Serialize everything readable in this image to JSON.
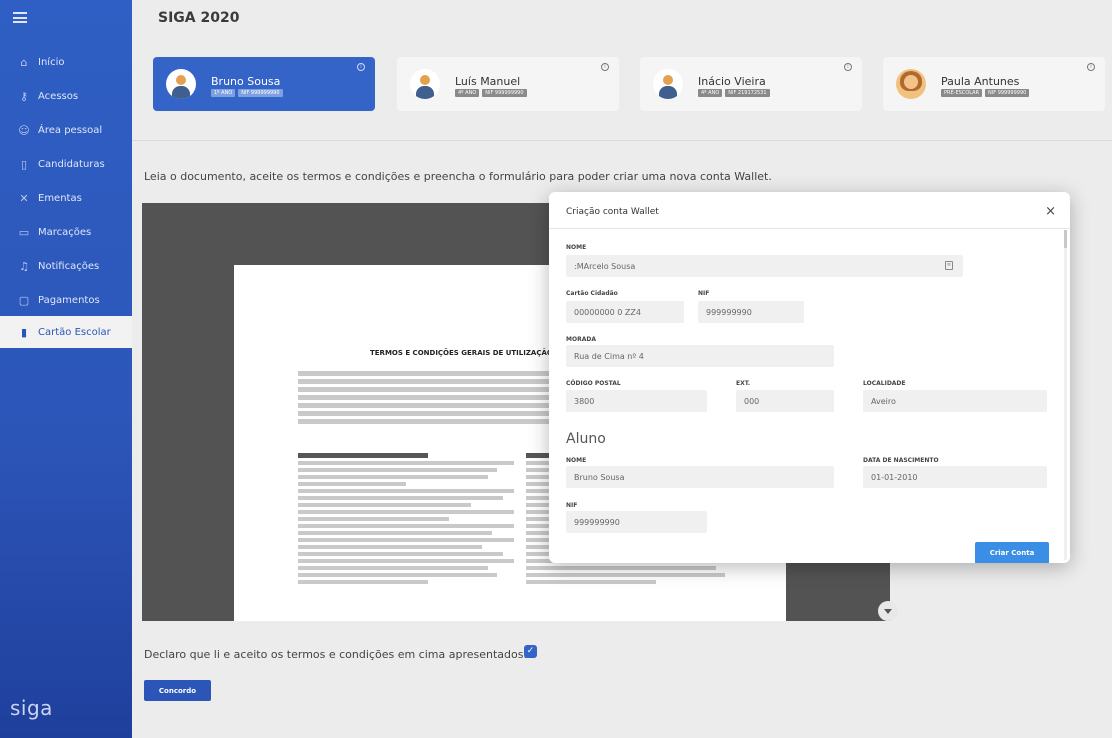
{
  "app": {
    "title": "SIGA 2020",
    "brand": "siga"
  },
  "sidebar": {
    "items": [
      {
        "label": "Início",
        "icon": "home-icon"
      },
      {
        "label": "Acessos",
        "icon": "key-icon"
      },
      {
        "label": "Área pessoal",
        "icon": "user-icon"
      },
      {
        "label": "Candidaturas",
        "icon": "document-icon"
      },
      {
        "label": "Ementas",
        "icon": "cutlery-icon"
      },
      {
        "label": "Marcações",
        "icon": "calendar-icon"
      },
      {
        "label": "Notificações",
        "icon": "bell-icon"
      },
      {
        "label": "Pagamentos",
        "icon": "wallet-icon"
      },
      {
        "label": "Cartão Escolar",
        "icon": "card-icon",
        "active": true
      }
    ]
  },
  "students": [
    {
      "name": "Bruno Sousa",
      "badges": [
        "1º ANO",
        "NIF 999999990"
      ],
      "active": true
    },
    {
      "name": "Luís Manuel",
      "badges": [
        "4º ANO",
        "NIF 999999990"
      ]
    },
    {
      "name": "Inácio Vieira",
      "badges": [
        "4º ANO",
        "NIF 219172531"
      ]
    },
    {
      "name": "Paula Antunes",
      "badges": [
        "PRÉ-ESCOLAR",
        "NIF 999999990"
      ]
    }
  ],
  "instructions": "Leia o documento, aceite os termos e condições e preencha o formulário para poder criar uma nova conta Wallet.",
  "document": {
    "title": "TERMOS E CONDIÇÕES GERAIS DE UTILIZAÇÃO DA \""
  },
  "declaration": {
    "text": "Declaro que li e aceito os termos e condições em cima apresentados.",
    "checked": true
  },
  "agree_button": "Concordo",
  "modal": {
    "title": "Criação conta Wallet",
    "close": "×",
    "guardian": {
      "name_label": "NOME",
      "name_value": ":MArcelo Sousa",
      "cc_label": "Cartão Cidadão",
      "cc_value": "00000000 0 ZZ4",
      "nif_label": "NIF",
      "nif_value": "999999990",
      "address_label": "MORADA",
      "address_value": "Rua de Cima nº 4",
      "postal_label": "CÓDIGO POSTAL",
      "postal_value": "3800",
      "ext_label": "EXT.",
      "ext_value": "000",
      "locality_label": "LOCALIDADE",
      "locality_value": "Aveiro"
    },
    "student_section": "Aluno",
    "student": {
      "name_label": "NOME",
      "name_value": "Bruno Sousa",
      "birth_label": "DATA DE NASCIMENTO",
      "birth_value": "01-01-2010",
      "nif_label": "NIF",
      "nif_value": "999999990"
    },
    "submit": "Criar Conta"
  },
  "colors": {
    "primary": "#2c55b8",
    "accent": "#3b8ee6"
  }
}
